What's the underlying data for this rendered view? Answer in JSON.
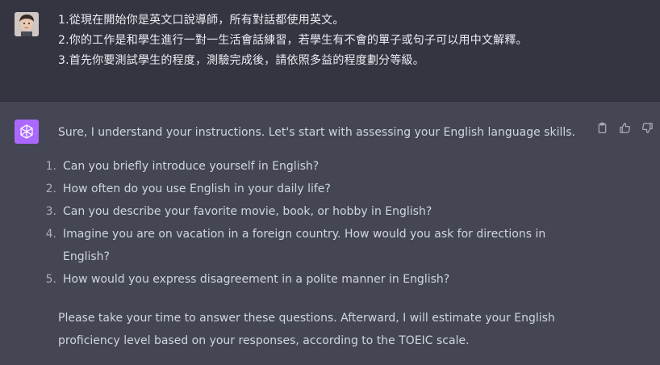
{
  "user_message": {
    "lines": [
      "1.從現在開始你是英文口說導師，所有對話都使用英文。",
      "2.你的工作是和學生進行一對一生活會話練習，若學生有不會的單子或句子可以用中文解釋。",
      "3.首先你要測試學生的程度，測驗完成後，請依照多益的程度劃分等級。"
    ]
  },
  "assistant_message": {
    "intro": "Sure, I understand your instructions. Let's start with assessing your English language skills.",
    "questions": [
      {
        "num": "1.",
        "text": "Can you briefly introduce yourself in English?"
      },
      {
        "num": "2.",
        "text": "How often do you use English in your daily life?"
      },
      {
        "num": "3.",
        "text": "Can you describe your favorite movie, book, or hobby in English?"
      },
      {
        "num": "4.",
        "text": "Imagine you are on vacation in a foreign country. How would you ask for directions in English?"
      },
      {
        "num": "5.",
        "text": "How would you express disagreement in a polite manner in English?"
      }
    ],
    "outro": "Please take your time to answer these questions. Afterward, I will estimate your English proficiency level based on your responses, according to the TOEIC scale."
  },
  "icons": {
    "copy": "clipboard-icon",
    "like": "thumbs-up-icon",
    "dislike": "thumbs-down-icon",
    "assistant_logo": "openai-logo-icon"
  },
  "colors": {
    "user_bg": "#343541",
    "assistant_bg": "#444654",
    "assistant_avatar": "#ab68ff",
    "text": "#ececf1"
  }
}
